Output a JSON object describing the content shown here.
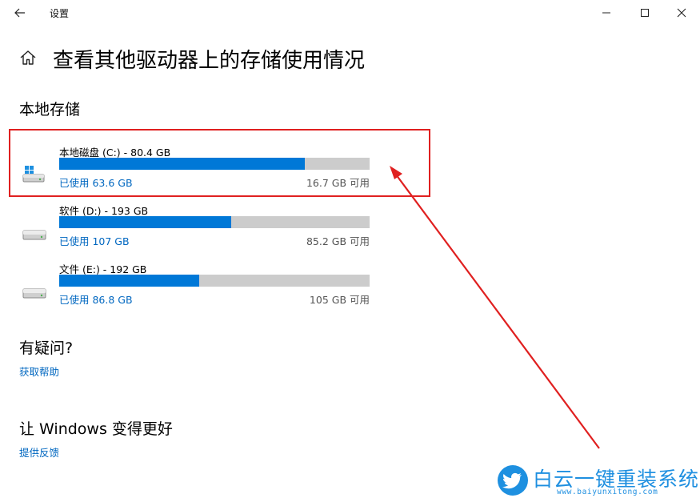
{
  "window": {
    "title": "设置",
    "back_icon": "back-arrow-icon",
    "controls": [
      "minimize-icon",
      "maximize-icon",
      "close-icon"
    ]
  },
  "header": {
    "icon": "home-icon",
    "title": "查看其他驱动器上的存储使用情况"
  },
  "storage": {
    "section_title": "本地存储",
    "drives": [
      {
        "name": "本地磁盘 (C:) - 80.4 GB",
        "used": "已使用 63.6 GB",
        "free": "16.7 GB 可用",
        "used_fraction": 0.79,
        "icon": "windows-drive-icon",
        "highlighted": true
      },
      {
        "name": "软件 (D:) - 193 GB",
        "used": "已使用 107 GB",
        "free": "85.2 GB 可用",
        "used_fraction": 0.555,
        "icon": "drive-icon"
      },
      {
        "name": "文件 (E:) - 192 GB",
        "used": "已使用 86.8 GB",
        "free": "105 GB 可用",
        "used_fraction": 0.452,
        "icon": "drive-icon"
      }
    ]
  },
  "help": {
    "title": "有疑问?",
    "link": "获取帮助"
  },
  "improve": {
    "title": "让 Windows 变得更好",
    "link": "提供反馈"
  },
  "annotation": {
    "color": "#e02020"
  },
  "watermark": {
    "text": "白云一键重装系统",
    "url": "www.baiyunxitong.com",
    "color": "#1e8fe0"
  },
  "colors": {
    "accent": "#0078d7",
    "bar_track": "#cccccc",
    "link": "#0067c0"
  }
}
